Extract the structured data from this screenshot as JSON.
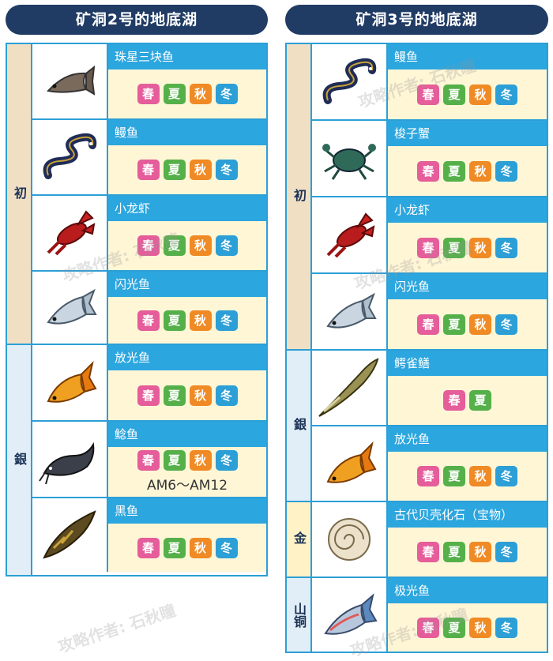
{
  "left": {
    "title": "矿洞2号的地底湖",
    "tiers": [
      {
        "label": "初"
      },
      {
        "label": "銀"
      }
    ],
    "fish": [
      {
        "name": "珠星三块鱼",
        "seasons": [
          "春",
          "夏",
          "秋",
          "冬"
        ],
        "icon": "dace-fish-icon"
      },
      {
        "name": "鳗鱼",
        "seasons": [
          "春",
          "夏",
          "秋",
          "冬"
        ],
        "icon": "eel-icon"
      },
      {
        "name": "小龙虾",
        "seasons": [
          "春",
          "夏",
          "秋",
          "冬"
        ],
        "icon": "crayfish-icon"
      },
      {
        "name": "闪光鱼",
        "seasons": [
          "春",
          "夏",
          "秋",
          "冬"
        ],
        "icon": "silver-fish-icon"
      },
      {
        "name": "放光鱼",
        "seasons": [
          "春",
          "夏",
          "秋",
          "冬"
        ],
        "icon": "golden-fish-icon"
      },
      {
        "name": "鲶鱼",
        "seasons": [
          "春",
          "夏",
          "秋",
          "冬"
        ],
        "note": "AM6～AM12",
        "icon": "catfish-icon"
      },
      {
        "name": "黑鱼",
        "seasons": [
          "春",
          "夏",
          "秋",
          "冬"
        ],
        "icon": "snakehead-icon"
      }
    ]
  },
  "right": {
    "title": "矿洞3号的地底湖",
    "tiers": [
      {
        "label": "初"
      },
      {
        "label": "銀"
      },
      {
        "label": "金"
      },
      {
        "label": "山铜"
      }
    ],
    "fish": [
      {
        "name": "鳗鱼",
        "seasons": [
          "春",
          "夏",
          "秋",
          "冬"
        ],
        "icon": "eel-icon"
      },
      {
        "name": "梭子蟹",
        "seasons": [
          "春",
          "夏",
          "秋",
          "冬"
        ],
        "icon": "crab-icon"
      },
      {
        "name": "小龙虾",
        "seasons": [
          "春",
          "夏",
          "秋",
          "冬"
        ],
        "icon": "crayfish-icon"
      },
      {
        "name": "闪光鱼",
        "seasons": [
          "春",
          "夏",
          "秋",
          "冬"
        ],
        "icon": "silver-fish-icon"
      },
      {
        "name": "鳄雀鳝",
        "seasons": [
          "春",
          "夏"
        ],
        "icon": "gar-icon"
      },
      {
        "name": "放光鱼",
        "seasons": [
          "春",
          "夏",
          "秋",
          "冬"
        ],
        "icon": "golden-fish-icon"
      },
      {
        "name": "古代贝壳化石（宝物）",
        "seasons": [
          "春",
          "夏",
          "秋",
          "冬"
        ],
        "icon": "ammonite-fossil-icon"
      },
      {
        "name": "极光鱼",
        "seasons": [
          "春",
          "夏",
          "秋",
          "冬"
        ],
        "icon": "aurora-fish-icon"
      }
    ]
  },
  "watermark": {
    "line1": "攻略作者:",
    "line2": "石秋瞳"
  },
  "colors": {
    "banner": "#203b64",
    "border": "#2c9fd6",
    "namebar": "#2ca6de",
    "season_bg": "#fff6d6",
    "spring": "#e55d9a",
    "summer": "#55b04a",
    "autumn": "#ef8a25",
    "winter": "#2c9fd6"
  }
}
